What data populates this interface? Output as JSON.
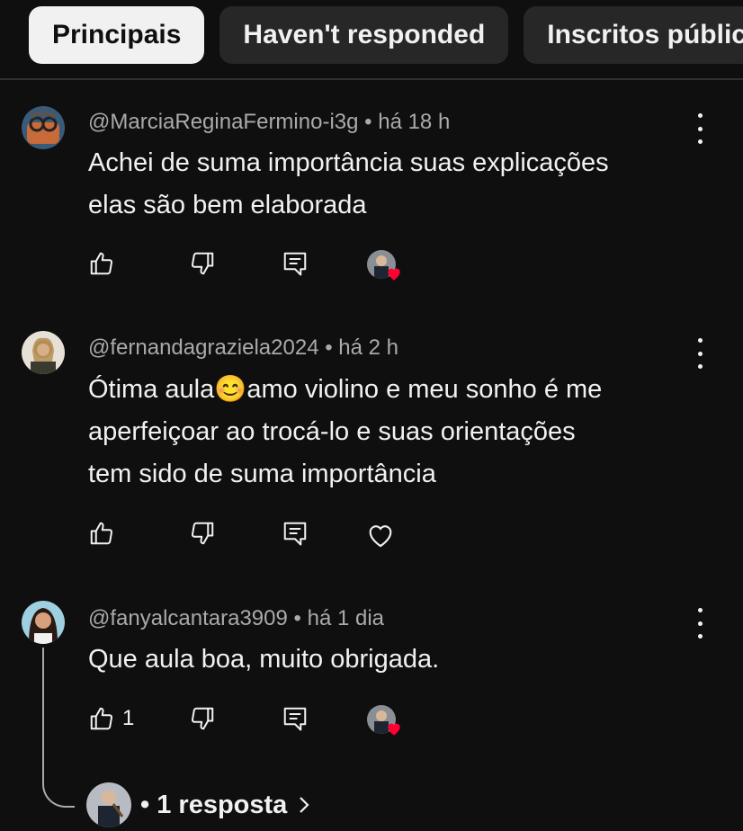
{
  "filters": [
    {
      "label": "Principais",
      "active": true
    },
    {
      "label": "Haven't responded",
      "active": false
    },
    {
      "label": "Inscritos públic",
      "active": false
    }
  ],
  "comments": [
    {
      "author": "@MarciaReginaFermino-i3g",
      "time": "há 18 h",
      "lines": [
        "Achei de suma importância suas explicações",
        "elas são bem elaborada"
      ],
      "likes": "",
      "hearted": true
    },
    {
      "author": "@fernandagraziela2024",
      "time": "há 2 h",
      "lines": [
        "Ótima aula",
        "amo violino e meu sonho é me",
        "aperfeiçoar ao trocá-lo e suas orientações",
        "tem sido de suma importância"
      ],
      "emoji": "😊",
      "likes": "",
      "hearted": false
    },
    {
      "author": "@fanyalcantara3909",
      "time": "há 1 dia",
      "lines": [
        "Que aula boa, muito obrigada."
      ],
      "likes": "1",
      "hearted": true
    }
  ],
  "separator": " • ",
  "replies": {
    "label": "1 resposta"
  },
  "icons": {
    "like": "thumbs-up-icon",
    "dislike": "thumbs-down-icon",
    "reply": "reply-icon",
    "heart": "heart-icon",
    "menu": "more-vert-icon",
    "chevron": "chevron-right-icon"
  },
  "colors": {
    "background": "#0f0f0f",
    "chip": "#272727",
    "heart": "#ff0033",
    "meta": "#aaaaaa"
  }
}
